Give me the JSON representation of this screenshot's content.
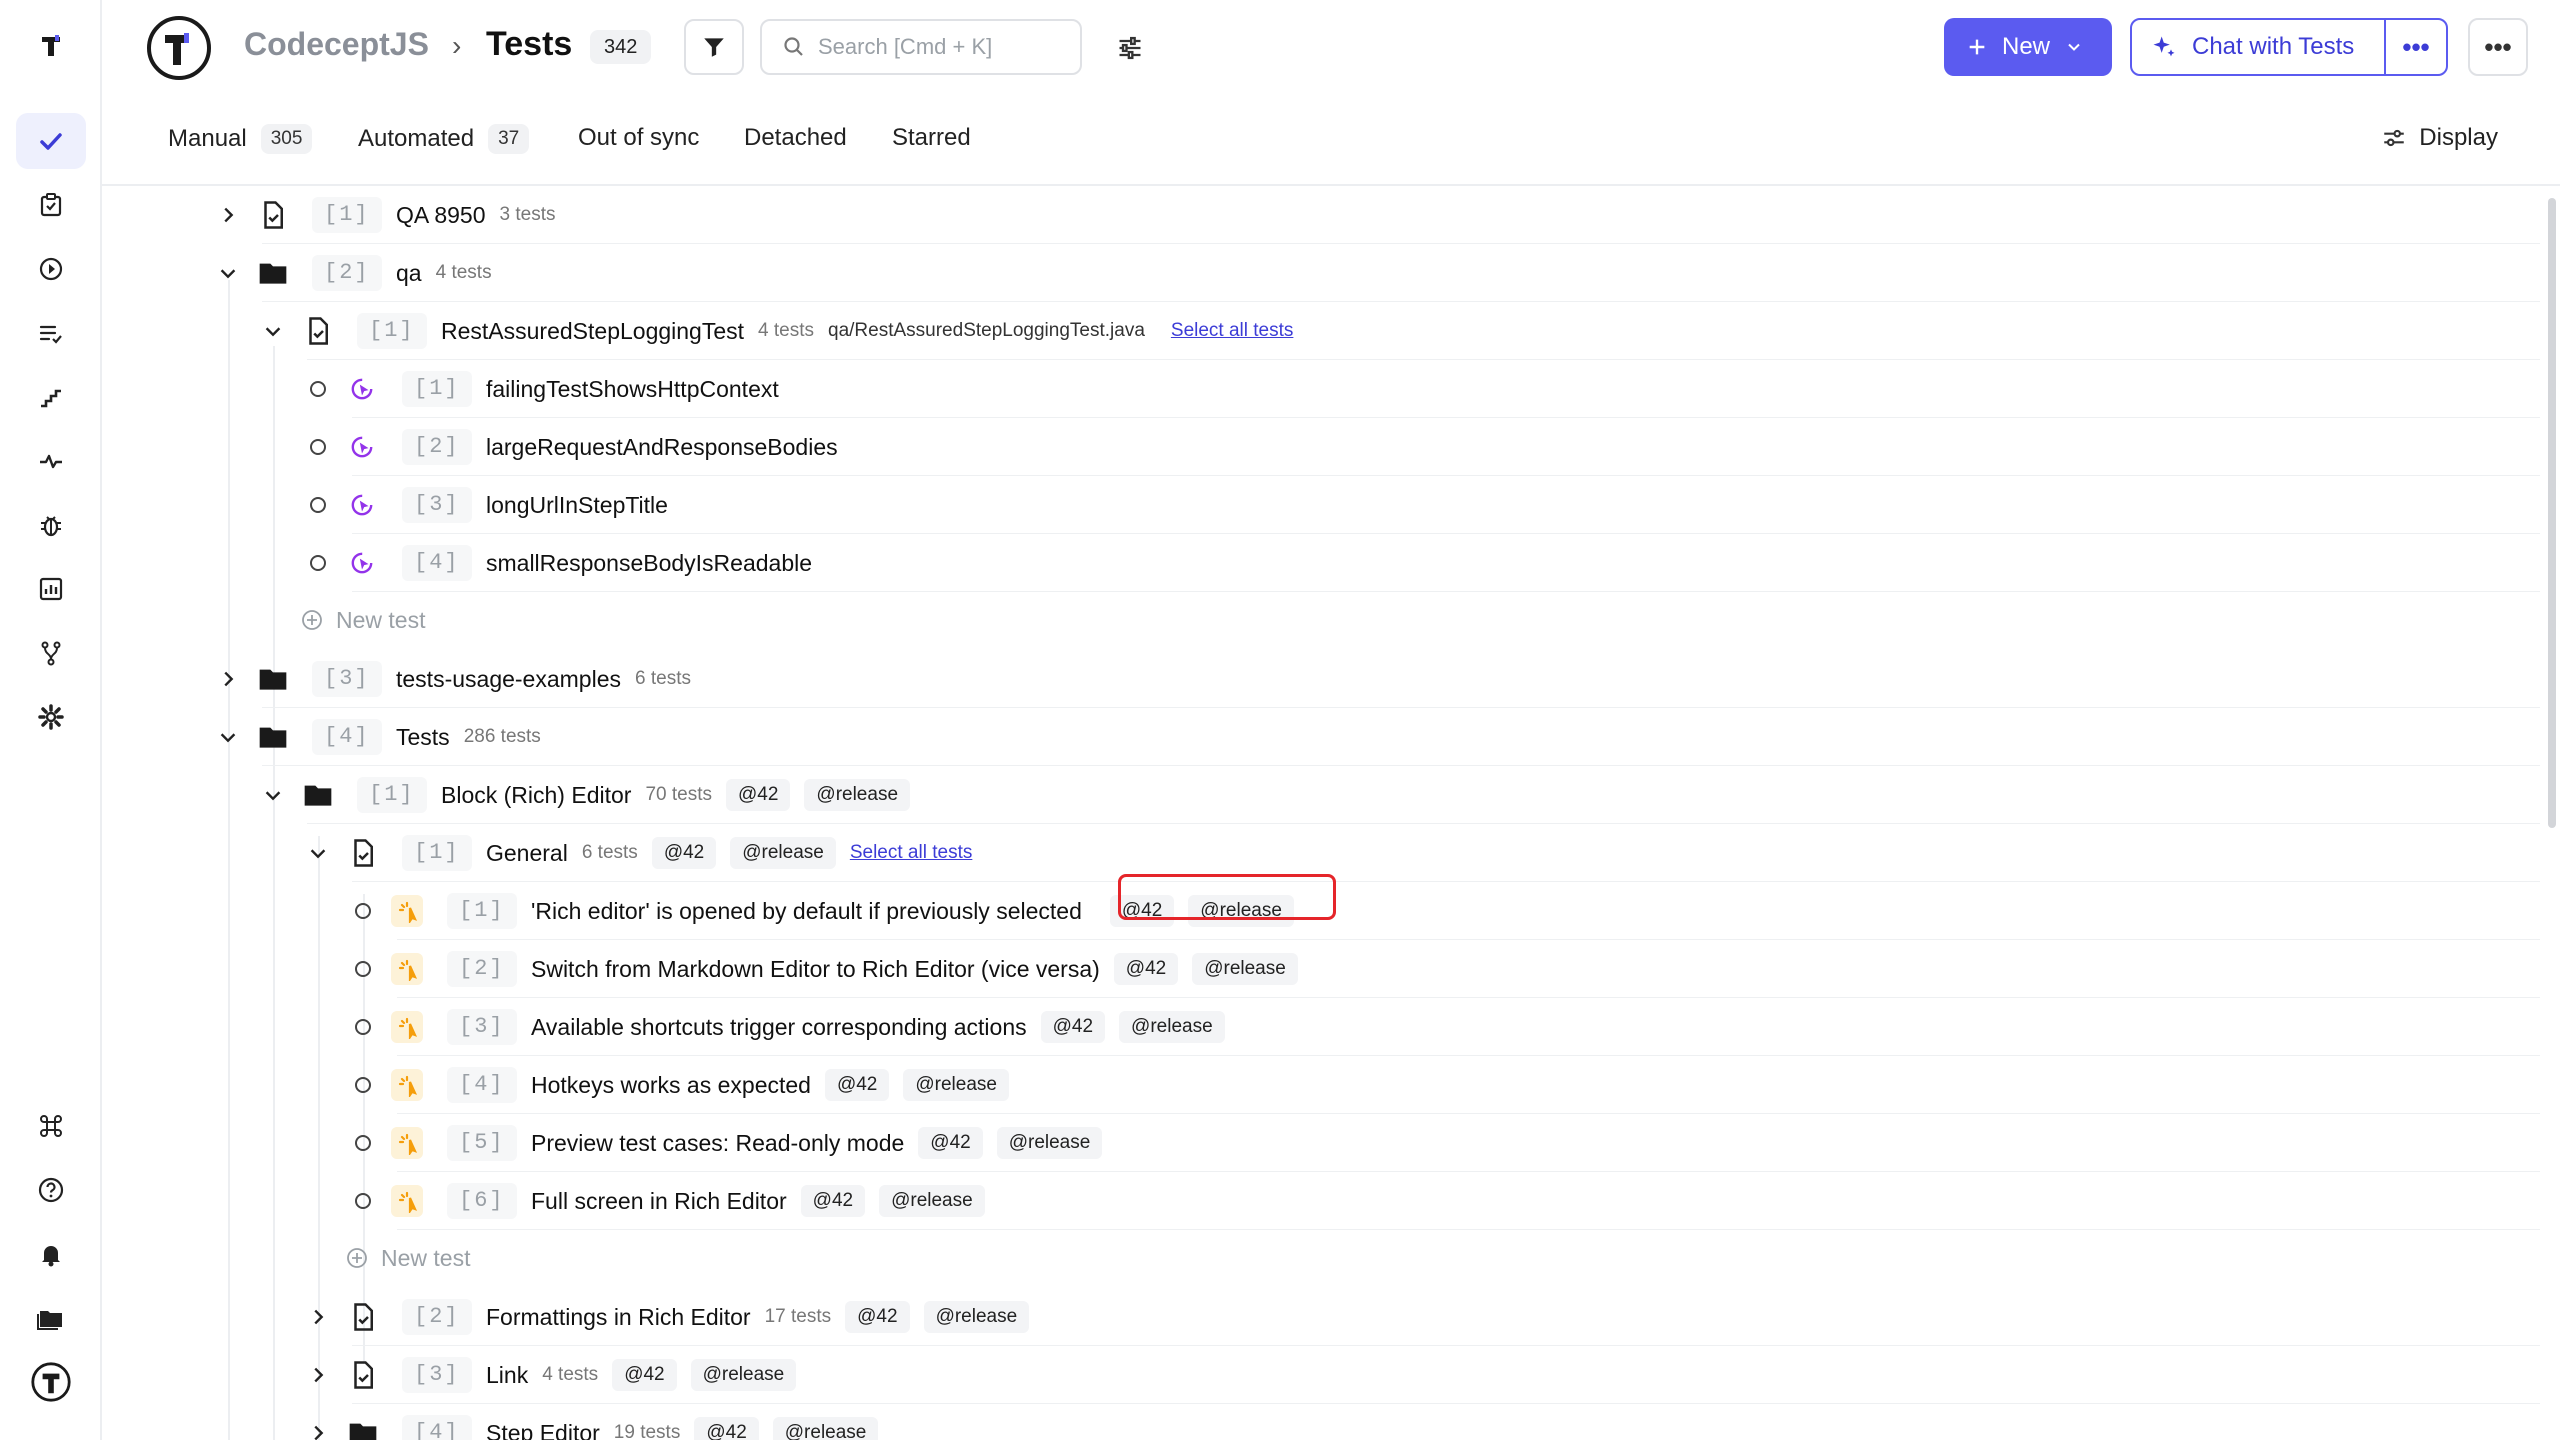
{
  "header": {
    "project": "CodeceptJS",
    "separator": "›",
    "title": "Tests",
    "count": "342",
    "search_placeholder": "Search [Cmd + K]",
    "new_label": "New",
    "chat_label": "Chat with Tests",
    "more_label": "•••"
  },
  "tabs": {
    "manual": {
      "label": "Manual",
      "count": "305"
    },
    "automated": {
      "label": "Automated",
      "count": "37"
    },
    "out_of_sync": {
      "label": "Out of sync"
    },
    "detached": {
      "label": "Detached"
    },
    "starred": {
      "label": "Starred"
    },
    "display": {
      "label": "Display"
    }
  },
  "tree": {
    "qa8950": {
      "num": "[1]",
      "name": "QA 8950",
      "meta": "3 tests"
    },
    "qa": {
      "num": "[2]",
      "name": "qa",
      "meta": "4 tests"
    },
    "restassured": {
      "num": "[1]",
      "name": "RestAssuredStepLoggingTest",
      "meta": "4 tests",
      "path": "qa/RestAssuredStepLoggingTest.java",
      "select_all": "Select all tests"
    },
    "rest_tests": [
      {
        "num": "[1]",
        "name": "failingTestShowsHttpContext"
      },
      {
        "num": "[2]",
        "name": "largeRequestAndResponseBodies"
      },
      {
        "num": "[3]",
        "name": "longUrlInStepTitle"
      },
      {
        "num": "[4]",
        "name": "smallResponseBodyIsReadable"
      }
    ],
    "new_test_label": "New test",
    "usage": {
      "num": "[3]",
      "name": "tests-usage-examples",
      "meta": "6 tests"
    },
    "tests_folder": {
      "num": "[4]",
      "name": "Tests",
      "meta": "286 tests"
    },
    "block_editor": {
      "num": "[1]",
      "name": "Block (Rich) Editor",
      "meta": "70 tests",
      "tag1": "@42",
      "tag2": "@release"
    },
    "general": {
      "num": "[1]",
      "name": "General",
      "meta": "6 tests",
      "tag1": "@42",
      "tag2": "@release",
      "select_all": "Select all tests"
    },
    "general_tests": [
      {
        "num": "[1]",
        "name": "'Rich editor' is opened by default if previously selected",
        "tag1": "@42",
        "tag2": "@release"
      },
      {
        "num": "[2]",
        "name": "Switch from Markdown Editor to Rich Editor (vice versa)",
        "tag1": "@42",
        "tag2": "@release"
      },
      {
        "num": "[3]",
        "name": "Available shortcuts trigger corresponding actions",
        "tag1": "@42",
        "tag2": "@release"
      },
      {
        "num": "[4]",
        "name": "Hotkeys works as expected",
        "tag1": "@42",
        "tag2": "@release"
      },
      {
        "num": "[5]",
        "name": "Preview test cases: Read-only mode",
        "tag1": "@42",
        "tag2": "@release"
      },
      {
        "num": "[6]",
        "name": "Full screen in Rich Editor",
        "tag1": "@42",
        "tag2": "@release"
      }
    ],
    "formattings": {
      "num": "[2]",
      "name": "Formattings in Rich Editor",
      "meta": "17 tests",
      "tag1": "@42",
      "tag2": "@release"
    },
    "link": {
      "num": "[3]",
      "name": "Link",
      "meta": "4 tests",
      "tag1": "@42",
      "tag2": "@release"
    },
    "step_editor": {
      "num": "[4]",
      "name": "Step Editor",
      "meta": "19 tests",
      "tag1": "@42",
      "tag2": "@release"
    }
  },
  "colors": {
    "accent": "#5b5bf0",
    "highlight": "#e5252a",
    "auto_icon": "#9333ea",
    "manual_icon": "#f59e0b"
  }
}
